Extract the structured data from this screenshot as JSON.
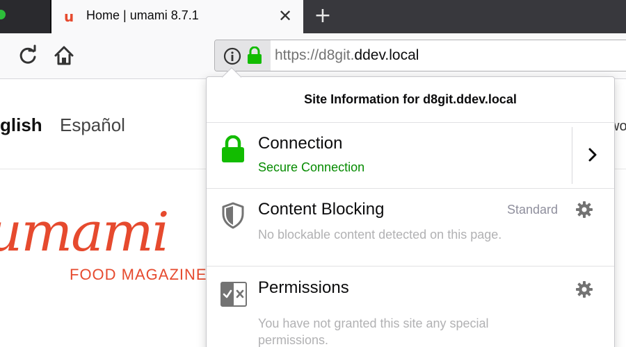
{
  "browser": {
    "tab": {
      "favicon": "u",
      "title": "Home | umami 8.7.1",
      "close_glyph": "✕"
    },
    "new_tab_glyph": "+",
    "urlbar": {
      "url_prefix": "https://d8git.",
      "url_domain": "ddev.local"
    },
    "icons": {
      "reload": "reload-icon",
      "home": "home-icon",
      "info": "info-icon",
      "lock": "lock-icon"
    }
  },
  "page": {
    "lang_english": "glish",
    "lang_espanol": "Español",
    "right_fragment": "wo",
    "logo_text": "umami",
    "logo_sub": "FOOD MAGAZINE"
  },
  "popup": {
    "title": "Site Information for d8git.ddev.local",
    "connection": {
      "heading": "Connection",
      "status": "Secure Connection",
      "status_color": "#058b00"
    },
    "content_blocking": {
      "heading": "Content Blocking",
      "mode": "Standard",
      "description": "No blockable content detected on this page."
    },
    "permissions": {
      "heading": "Permissions",
      "description_line1": "You have not granted this site any special",
      "description_line2": "permissions."
    }
  },
  "colors": {
    "accent_green": "#12bc00",
    "brand_umami": "#e64a2e",
    "tab_bar": "#38383d"
  }
}
